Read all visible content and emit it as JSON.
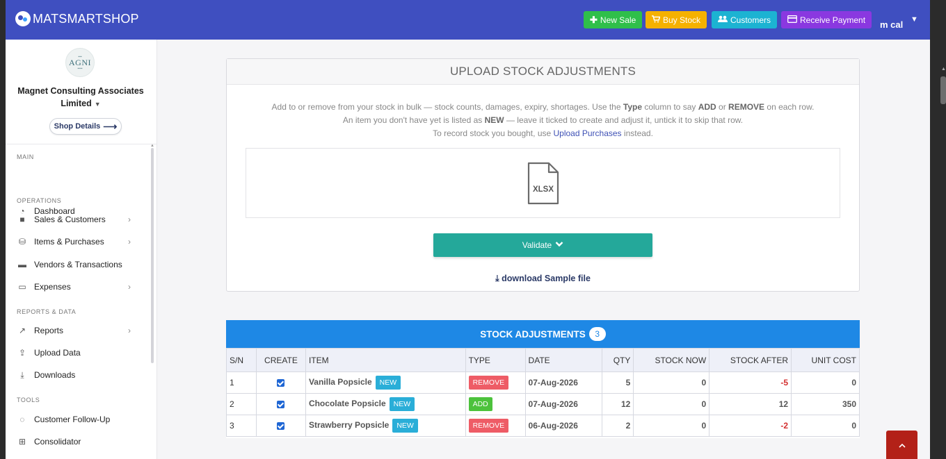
{
  "app": {
    "brand": "MATSMARTSHOP",
    "colors": {
      "topbar": "#3f4fc0",
      "accent": "#1e88e5",
      "validate": "#24a89a",
      "danger": "#d32f2f"
    }
  },
  "topbar": {
    "buttons": [
      {
        "label": "New Sale",
        "icon": "plus-icon",
        "color": "#2fbf4a"
      },
      {
        "label": "Buy Stock",
        "icon": "cart-icon",
        "color": "#f5b100"
      },
      {
        "label": "Customers",
        "icon": "users-icon",
        "color": "#1cb3d2"
      },
      {
        "label": "Receive Payment",
        "icon": "card-icon",
        "color": "#8a38e0"
      }
    ],
    "user": "m cal"
  },
  "sidebar": {
    "shop_logo_text": "AGNI",
    "shop_name": "Magnet Consulting Associates Limited",
    "shop_details": "Shop Details",
    "sections": [
      {
        "heading": "MAIN",
        "items": [
          {
            "label": "Dashboard",
            "icon": "dashboard-icon"
          }
        ]
      },
      {
        "heading": "OPERATIONS",
        "items": [
          {
            "label": "Sales & Customers",
            "icon": "shopping-bag-icon",
            "submenu": true
          },
          {
            "label": "Items & Purchases",
            "icon": "cubes-icon",
            "submenu": true
          },
          {
            "label": "Vendors & Transactions",
            "icon": "truck-icon",
            "submenu": false
          },
          {
            "label": "Expenses",
            "icon": "credit-card-icon",
            "submenu": true
          }
        ]
      },
      {
        "heading": "REPORTS & DATA",
        "items": [
          {
            "label": "Reports",
            "icon": "line-chart-icon",
            "submenu": true
          },
          {
            "label": "Upload Data",
            "icon": "upload-icon",
            "submenu": false
          },
          {
            "label": "Downloads",
            "icon": "download-icon",
            "submenu": false
          }
        ]
      },
      {
        "heading": "TOOLS",
        "items": [
          {
            "label": "Customer Follow-Up",
            "icon": "chat-icon",
            "submenu": false
          },
          {
            "label": "Consolidator",
            "icon": "sitemap-icon",
            "submenu": false
          }
        ]
      }
    ]
  },
  "upload": {
    "title": "UPLOAD STOCK ADJUSTMENTS",
    "line1_a": "Add to or remove from your stock in bulk — stock counts, damages, expiry, shortages. Use the ",
    "line1_b": "Type",
    "line1_c": " column to say ",
    "line1_d": "ADD",
    "line1_e": " or ",
    "line1_f": "REMOVE",
    "line1_g": " on each row.",
    "line2_a": "An item you don't have yet is listed as ",
    "line2_b": "NEW",
    "line2_c": " — leave it ticked to create and adjust it, untick it to skip that row.",
    "line3_a": "To record stock you bought, use ",
    "line3_link": "Upload Purchases",
    "line3_c": " instead.",
    "file_label": "XLSX",
    "validate": "Validate",
    "download": "download Sample file"
  },
  "adjustments": {
    "title": "STOCK ADJUSTMENTS",
    "count": "3",
    "columns": [
      "S/N",
      "CREATE",
      "ITEM",
      "TYPE",
      "DATE",
      "QTY",
      "STOCK NOW",
      "STOCK AFTER",
      "UNIT COST"
    ],
    "rows": [
      {
        "sn": "1",
        "create": true,
        "item": "Vanilla Popsicle",
        "tag": "NEW",
        "type": "REMOVE",
        "date": "07-Aug-2026",
        "qty": "5",
        "stock_now": "0",
        "stock_after": "-5",
        "unit_cost": "0"
      },
      {
        "sn": "2",
        "create": true,
        "item": "Chocolate Popsicle",
        "tag": "NEW",
        "type": "ADD",
        "date": "07-Aug-2026",
        "qty": "12",
        "stock_now": "0",
        "stock_after": "12",
        "unit_cost": "350"
      },
      {
        "sn": "3",
        "create": true,
        "item": "Strawberry Popsicle",
        "tag": "NEW",
        "type": "REMOVE",
        "date": "06-Aug-2026",
        "qty": "2",
        "stock_now": "0",
        "stock_after": "-2",
        "unit_cost": "0"
      }
    ]
  }
}
